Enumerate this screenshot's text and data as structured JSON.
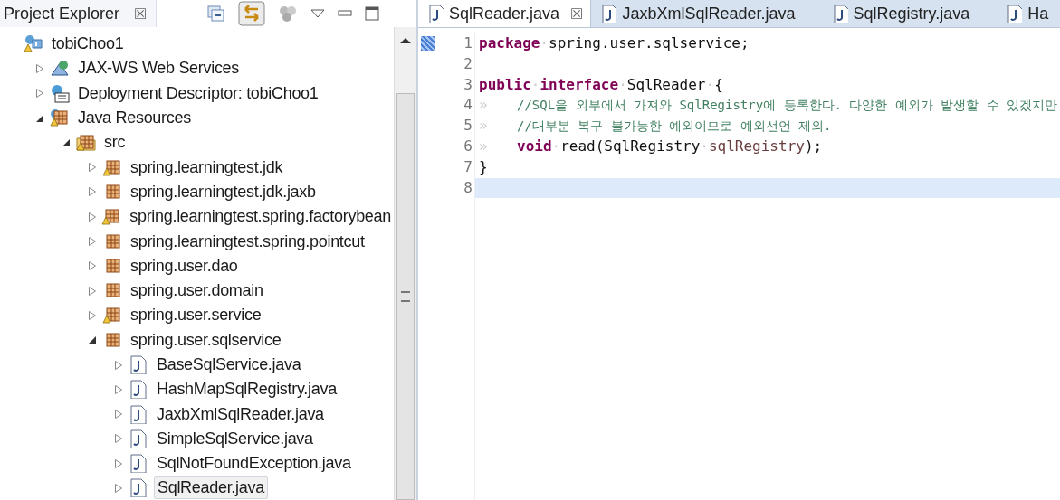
{
  "explorer": {
    "title": "Project Explorer",
    "close": "☒",
    "tree": [
      {
        "label": "tobiChoo1",
        "kind": "project",
        "warning": true,
        "selected": false,
        "children": [
          {
            "label": "JAX-WS Web Services",
            "kind": "webservices",
            "expanded": false,
            "selected": false
          },
          {
            "label": "Deployment Descriptor: tobiChoo1",
            "kind": "descriptor",
            "expanded": false,
            "selected": false
          },
          {
            "label": "Java Resources",
            "kind": "resources",
            "warning": true,
            "expanded": true,
            "selected": false,
            "children": [
              {
                "label": "src",
                "kind": "source-folder",
                "warning": true,
                "expanded": true,
                "selected": false,
                "children": [
                  {
                    "label": "spring.learningtest.jdk",
                    "kind": "package",
                    "warning": true,
                    "expanded": false,
                    "selected": false
                  },
                  {
                    "label": "spring.learningtest.jdk.jaxb",
                    "kind": "package",
                    "warning": false,
                    "expanded": false,
                    "selected": false
                  },
                  {
                    "label": "spring.learningtest.spring.factorybean",
                    "kind": "package",
                    "warning": true,
                    "expanded": false,
                    "selected": false
                  },
                  {
                    "label": "spring.learningtest.spring.pointcut",
                    "kind": "package",
                    "warning": false,
                    "expanded": false,
                    "selected": false
                  },
                  {
                    "label": "spring.user.dao",
                    "kind": "package",
                    "warning": false,
                    "expanded": false,
                    "selected": false
                  },
                  {
                    "label": "spring.user.domain",
                    "kind": "package",
                    "warning": false,
                    "expanded": false,
                    "selected": false
                  },
                  {
                    "label": "spring.user.service",
                    "kind": "package",
                    "warning": true,
                    "expanded": false,
                    "selected": false
                  },
                  {
                    "label": "spring.user.sqlservice",
                    "kind": "package",
                    "warning": false,
                    "expanded": true,
                    "selected": false,
                    "children": [
                      {
                        "label": "BaseSqlService.java",
                        "kind": "java-file",
                        "expanded": false,
                        "selected": false
                      },
                      {
                        "label": "HashMapSqlRegistry.java",
                        "kind": "java-file",
                        "expanded": false,
                        "selected": false
                      },
                      {
                        "label": "JaxbXmlSqlReader.java",
                        "kind": "java-file",
                        "expanded": false,
                        "selected": false
                      },
                      {
                        "label": "SimpleSqlService.java",
                        "kind": "java-file",
                        "expanded": false,
                        "selected": false
                      },
                      {
                        "label": "SqlNotFoundException.java",
                        "kind": "java-file",
                        "expanded": false,
                        "selected": false
                      },
                      {
                        "label": "SqlReader.java",
                        "kind": "java-file",
                        "expanded": false,
                        "selected": true
                      }
                    ]
                  }
                ]
              }
            ]
          }
        ]
      }
    ]
  },
  "editor": {
    "tabs": [
      {
        "label": "SqlReader.java",
        "selected": true,
        "close": "☒"
      },
      {
        "label": "JaxbXmlSqlReader.java",
        "selected": false
      },
      {
        "label": "SqlRegistry.java",
        "selected": false
      },
      {
        "label": "Ha",
        "selected": false
      }
    ],
    "lines": [
      {
        "number": "1",
        "current": false,
        "marker": true,
        "tokens": [
          {
            "kind": "keyword",
            "text": "package"
          },
          {
            "kind": "ws",
            "text": "·"
          },
          {
            "kind": "plain",
            "text": "spring.user.sqlservice;"
          }
        ]
      },
      {
        "number": "2",
        "current": false
      },
      {
        "number": "3",
        "current": false,
        "tokens": [
          {
            "kind": "keyword",
            "text": "public"
          },
          {
            "kind": "ws",
            "text": "·"
          },
          {
            "kind": "keyword",
            "text": "interface"
          },
          {
            "kind": "ws",
            "text": "·"
          },
          {
            "kind": "plain",
            "text": "SqlReader"
          },
          {
            "kind": "ws",
            "text": "·"
          },
          {
            "kind": "plain",
            "text": "{"
          }
        ]
      },
      {
        "number": "4",
        "current": false,
        "tokens": [
          {
            "kind": "tab",
            "text": "»"
          },
          {
            "kind": "comment",
            "text": "//SQL을 외부에서 가져와 SqlRegistry에 등록한다. 다양한 예외가 발생할 수 있겠지만"
          }
        ]
      },
      {
        "number": "5",
        "current": false,
        "tokens": [
          {
            "kind": "tab",
            "text": "»"
          },
          {
            "kind": "comment",
            "text": "//대부분 복구 불가능한 예외이므로 예외선언 제외."
          }
        ]
      },
      {
        "number": "6",
        "current": false,
        "tokens": [
          {
            "kind": "tab",
            "text": "»"
          },
          {
            "kind": "keyword",
            "text": "void"
          },
          {
            "kind": "ws",
            "text": "·"
          },
          {
            "kind": "plain",
            "text": "read(SqlRegistry"
          },
          {
            "kind": "ws",
            "text": "·"
          },
          {
            "kind": "param",
            "text": "sqlRegistry"
          },
          {
            "kind": "plain",
            "text": ");"
          }
        ]
      },
      {
        "number": "7",
        "current": false,
        "tokens": [
          {
            "kind": "plain",
            "text": "}"
          }
        ]
      },
      {
        "number": "8",
        "current": true
      }
    ]
  }
}
